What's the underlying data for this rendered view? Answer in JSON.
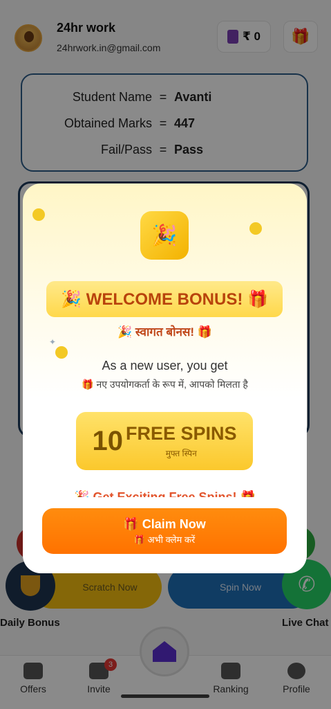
{
  "header": {
    "app_name": "24hr work",
    "email": "24hrwork.in@gmail.com",
    "wallet_amount": "₹ 0"
  },
  "result": {
    "rows": [
      {
        "key": "Student Name",
        "sep": "=",
        "value": "Avanti"
      },
      {
        "key": "Obtained Marks",
        "sep": "=",
        "value": "447"
      },
      {
        "key": "Fail/Pass",
        "sep": "=",
        "value": "Pass"
      }
    ]
  },
  "actions": {
    "scratch_label": "Scratch Now",
    "spin_label": "Spin Now",
    "daily_bonus_label": "Daily Bonus",
    "live_chat_label": "Live Chat"
  },
  "nav": {
    "items": [
      {
        "label": "Offers"
      },
      {
        "label": "Invite",
        "badge": "3"
      },
      {
        "label": "Ranking"
      },
      {
        "label": "Profile"
      }
    ]
  },
  "modal": {
    "welcome_title": "🎉 WELCOME BONUS! 🎁",
    "welcome_hindi": "🎉 स्वागत बोनस! 🎁",
    "new_user_text": "As a new user, you get",
    "new_user_hindi": "🎁 नए उपयोगकर्ता के रूप में, आपको मिलता है",
    "spins_count": "10",
    "spins_label": "FREE SPINS",
    "spins_hindi": "मुफ्त स्पिन",
    "exciting_text": "🎉 Get Exciting Free Spins! 🎁",
    "claim_label": "🎁 Claim Now",
    "claim_hindi": "🎁 अभी क्लेम करें"
  },
  "colors": {
    "accent_orange": "#ff7a00",
    "gold": "#fbc82c",
    "dark_blue": "#2d5d8a"
  }
}
